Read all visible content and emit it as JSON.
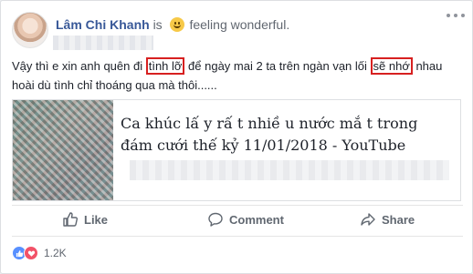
{
  "post": {
    "author": "Lâm Chi Khanh",
    "is_text": "is",
    "feeling": "feeling wonderful.",
    "text": {
      "part1": "Vậy thì e xin anh quên đi ",
      "highlight1": "tình lỡ",
      "part2": " để ngày mai 2 ta trên ngàn vạn lối ",
      "highlight2": "sẽ nhớ",
      "part3": " nhau hoài dù tình chỉ thoáng qua mà thôi......"
    },
    "link": {
      "title": "Ca khúc lấ y rấ t nhiề u nước mắ t trong đám cưới thế kỷ 11/01/2018 - YouTube"
    },
    "actions": {
      "like": "Like",
      "comment": "Comment",
      "share": "Share"
    },
    "reactions": {
      "count": "1.2K"
    }
  },
  "colors": {
    "author": "#385898",
    "highlight_border": "#d72020",
    "like_reaction": "#5890ff",
    "love_reaction": "#f25268"
  },
  "icons": [
    "more-dots-icon",
    "smiley-icon",
    "like-icon",
    "comment-icon",
    "share-icon",
    "like-reaction-icon",
    "love-reaction-icon"
  ]
}
